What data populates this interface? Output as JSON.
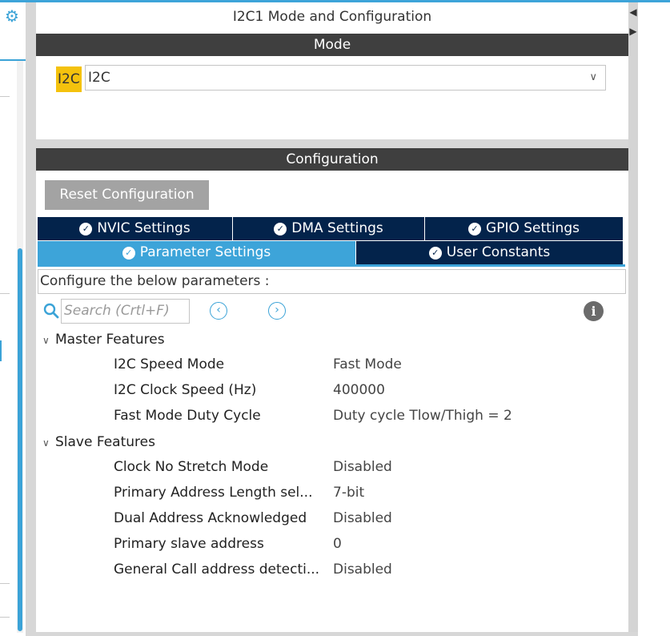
{
  "panel_title": "I2C1 Mode and Configuration",
  "mode": {
    "section_label": "Mode",
    "field_label": "I2C",
    "selected_value": "I2C"
  },
  "configuration": {
    "section_label": "Configuration",
    "reset_button": "Reset Configuration",
    "tabs": [
      {
        "label": "NVIC Settings",
        "active": false
      },
      {
        "label": "DMA Settings",
        "active": false
      },
      {
        "label": "GPIO Settings",
        "active": false
      },
      {
        "label": "Parameter Settings",
        "active": true
      },
      {
        "label": "User Constants",
        "active": false
      }
    ],
    "description": "Configure the below parameters :",
    "search_placeholder": "Search (Crtl+F)"
  },
  "parameters": {
    "groups": [
      {
        "name": "Master Features",
        "items": [
          {
            "name": "I2C Speed Mode",
            "value": "Fast Mode"
          },
          {
            "name": "I2C Clock Speed (Hz)",
            "value": "400000"
          },
          {
            "name": "Fast Mode Duty Cycle",
            "value": "Duty cycle Tlow/Thigh = 2"
          }
        ]
      },
      {
        "name": "Slave Features",
        "items": [
          {
            "name": "Clock No Stretch Mode",
            "value": "Disabled"
          },
          {
            "name": "Primary Address Length sel...",
            "value": "7-bit"
          },
          {
            "name": "Dual Address Acknowledged",
            "value": "Disabled"
          },
          {
            "name": "Primary slave address",
            "value": "0"
          },
          {
            "name": "General Call address detecti...",
            "value": "Disabled"
          }
        ]
      }
    ]
  },
  "icons": {
    "settings": "gear-icon",
    "search": "search-icon",
    "previous": "chevron-left-icon",
    "next": "chevron-right-icon",
    "info": "info-icon",
    "tab_check": "check-circle-icon"
  },
  "colors": {
    "accent": "#3da4d9",
    "tab_dark": "#03234b",
    "section_bar": "#3f3f3f",
    "highlight": "#f4c20d",
    "reset_button": "#a3a3a3"
  }
}
